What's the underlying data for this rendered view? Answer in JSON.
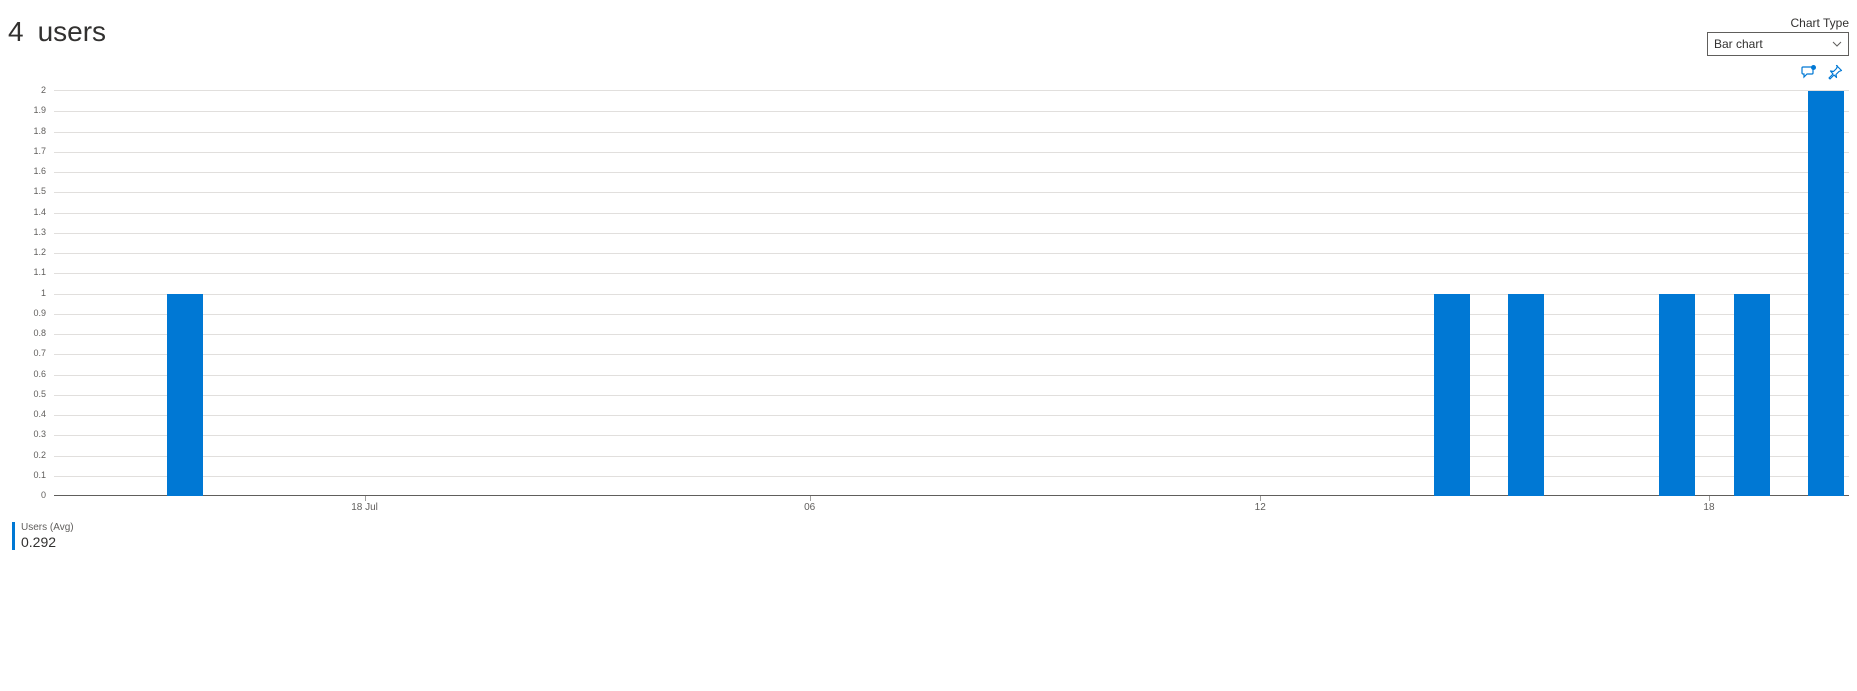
{
  "header": {
    "count": "4",
    "label": "users"
  },
  "chart_type": {
    "label": "Chart Type",
    "selected": "Bar chart"
  },
  "legend": {
    "name": "Users (Avg)",
    "value": "0.292"
  },
  "colors": {
    "bar": "#0078d4",
    "accent": "#0078d4"
  },
  "chart_data": {
    "type": "bar",
    "ylabel": "",
    "xlabel": "",
    "ylim": [
      0,
      2
    ],
    "y_ticks": [
      0,
      0.1,
      0.2,
      0.3,
      0.4,
      0.5,
      0.6,
      0.7,
      0.8,
      0.9,
      1,
      1.1,
      1.2,
      1.3,
      1.4,
      1.5,
      1.6,
      1.7,
      1.8,
      1.9,
      2
    ],
    "x_ticks": [
      {
        "pos_pct": 17.3,
        "label": "18 Jul"
      },
      {
        "pos_pct": 42.1,
        "label": "06"
      },
      {
        "pos_pct": 67.2,
        "label": "12"
      },
      {
        "pos_pct": 92.2,
        "label": "18"
      }
    ],
    "bars": [
      {
        "pos_pct": 8.3,
        "value": 1
      },
      {
        "pos_pct": 78.9,
        "value": 1
      },
      {
        "pos_pct": 83.0,
        "value": 1
      },
      {
        "pos_pct": 91.4,
        "value": 1
      },
      {
        "pos_pct": 95.6,
        "value": 1
      },
      {
        "pos_pct": 99.7,
        "value": 2
      }
    ],
    "bar_width_pct": 2.0
  }
}
